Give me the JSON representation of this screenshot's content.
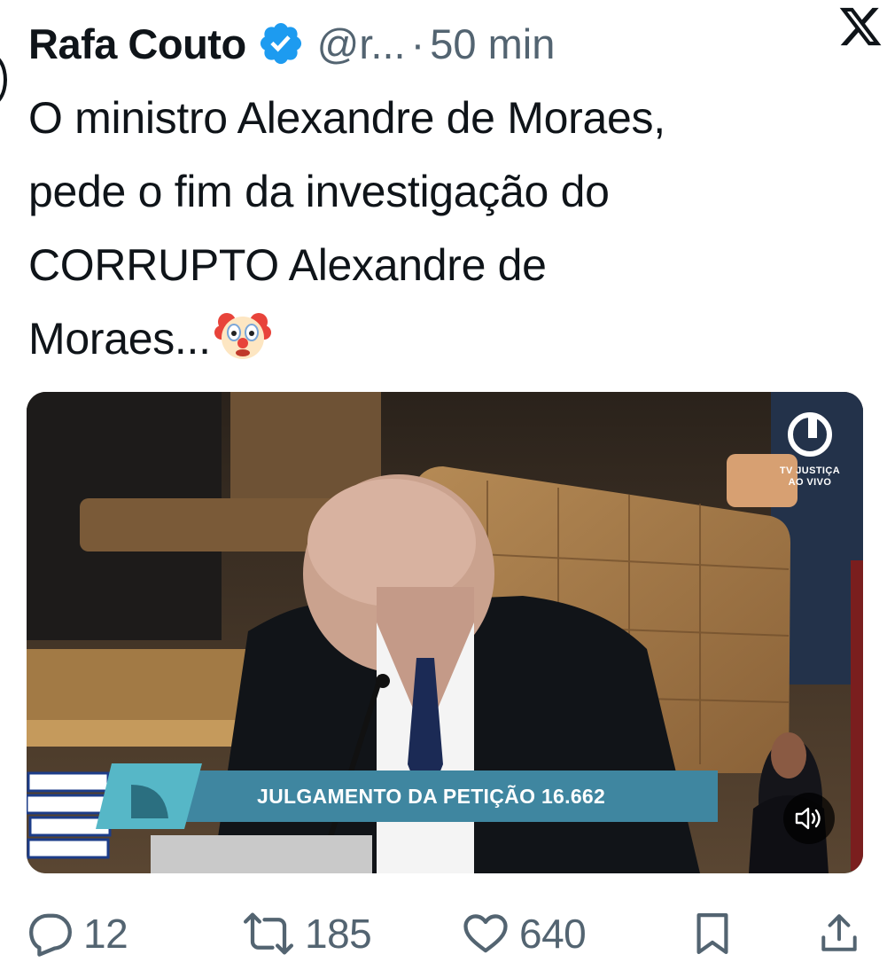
{
  "tweet": {
    "author_name": "Rafa Couto",
    "handle": "@r...",
    "separator": "·",
    "time": "50 min",
    "text": "O ministro Alexandre de Moraes,\npede o fim da investigação do\nCORRUPTO Alexandre de\nMoraes...",
    "emoji": "clown-face"
  },
  "media": {
    "broadcaster_line1": "TV JUSTIÇA",
    "broadcaster_line2": "AO VIVO",
    "caption": "JULGAMENTO DA PETIÇÃO 16.662",
    "mute_icon": "speaker-muted-icon"
  },
  "actions": {
    "replies": "12",
    "reposts": "185",
    "likes": "640"
  },
  "colors": {
    "verified": "#1d9bf0",
    "text": "#0f1419",
    "muted": "#536471",
    "caption_bar": "#3f86a0"
  }
}
